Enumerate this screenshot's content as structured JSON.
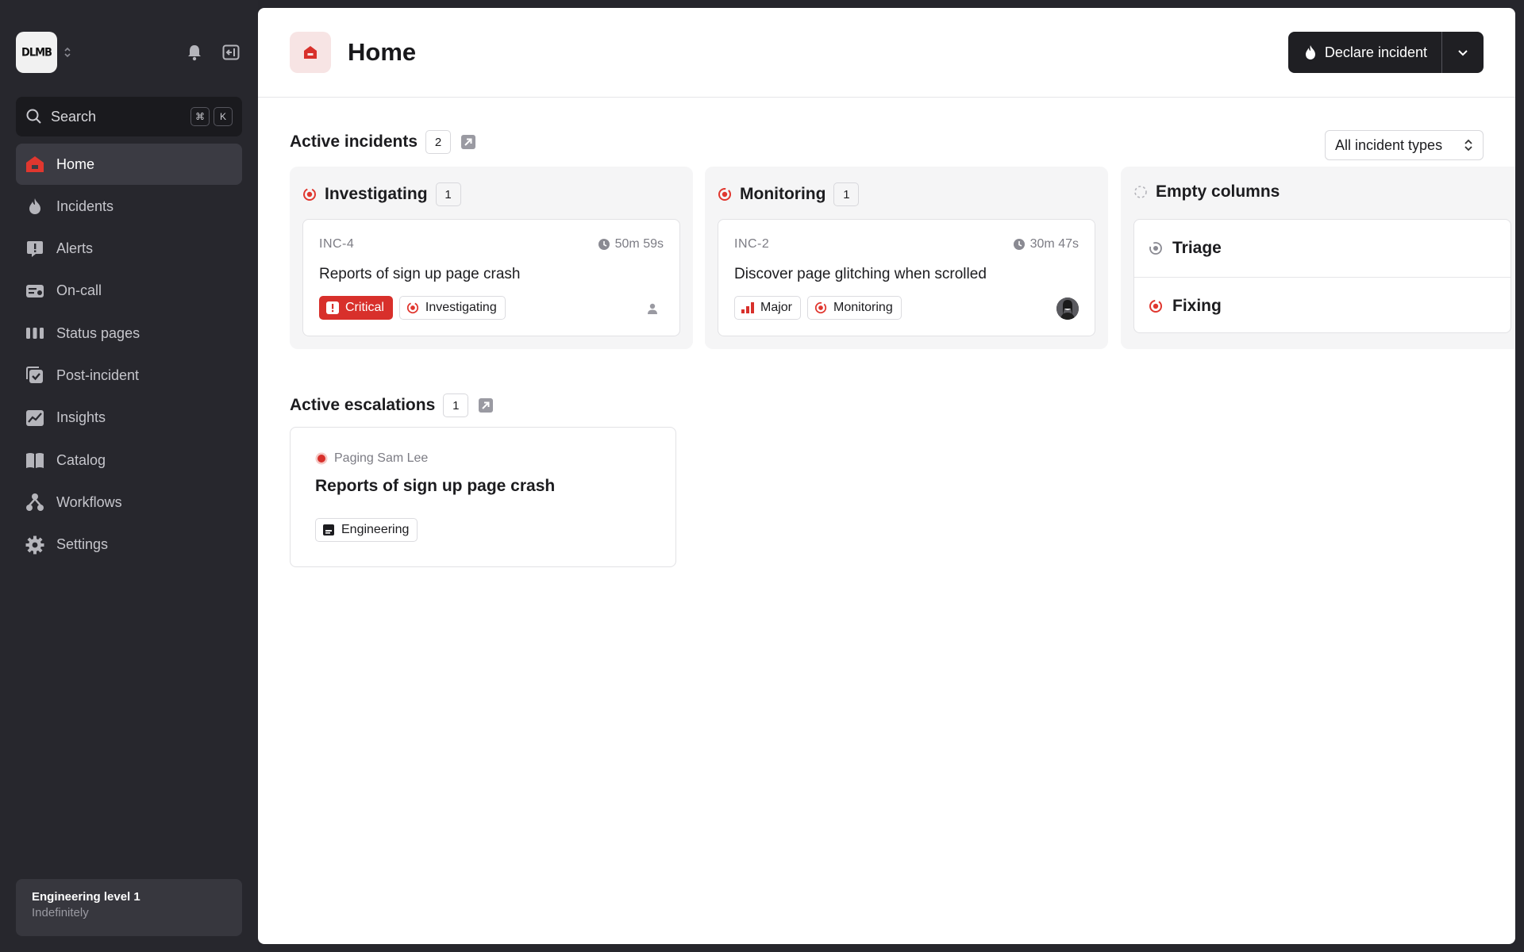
{
  "sidebar": {
    "logo_text": "DLMB",
    "search": {
      "label": "Search",
      "shortcut_keys": [
        "⌘",
        "K"
      ]
    },
    "items": [
      {
        "label": "Home",
        "icon": "home-icon",
        "active": true
      },
      {
        "label": "Incidents",
        "icon": "flame-icon"
      },
      {
        "label": "Alerts",
        "icon": "alert-icon"
      },
      {
        "label": "On-call",
        "icon": "oncall-icon"
      },
      {
        "label": "Status pages",
        "icon": "status-bars-icon"
      },
      {
        "label": "Post-incident",
        "icon": "post-incident-icon"
      },
      {
        "label": "Insights",
        "icon": "chart-icon"
      },
      {
        "label": "Catalog",
        "icon": "book-icon"
      },
      {
        "label": "Workflows",
        "icon": "workflow-icon"
      },
      {
        "label": "Settings",
        "icon": "gear-icon"
      }
    ],
    "oncall": {
      "title": "Engineering level 1",
      "subtitle": "Indefinitely"
    }
  },
  "header": {
    "title": "Home",
    "declare_label": "Declare incident"
  },
  "active_incidents": {
    "title": "Active incidents",
    "count": "2",
    "filter_label": "All incident types",
    "columns": [
      {
        "title": "Investigating",
        "count": "1",
        "card": {
          "id": "INC-4",
          "duration": "50m 59s",
          "name": "Reports of sign up page crash",
          "severity": "Critical",
          "status": "Investigating"
        }
      },
      {
        "title": "Monitoring",
        "count": "1",
        "card": {
          "id": "INC-2",
          "duration": "30m 47s",
          "name": "Discover page glitching when scrolled",
          "severity": "Major",
          "status": "Monitoring"
        }
      },
      {
        "title": "Empty columns",
        "rows": [
          "Triage",
          "Fixing"
        ]
      }
    ]
  },
  "active_escalations": {
    "title": "Active escalations",
    "count": "1",
    "card": {
      "status": "Paging Sam Lee",
      "title": "Reports of sign up page crash",
      "team": "Engineering"
    }
  },
  "colors": {
    "accent_red": "#d8302b",
    "sidebar_bg": "#27272d",
    "primary_button": "#1f1f23"
  }
}
